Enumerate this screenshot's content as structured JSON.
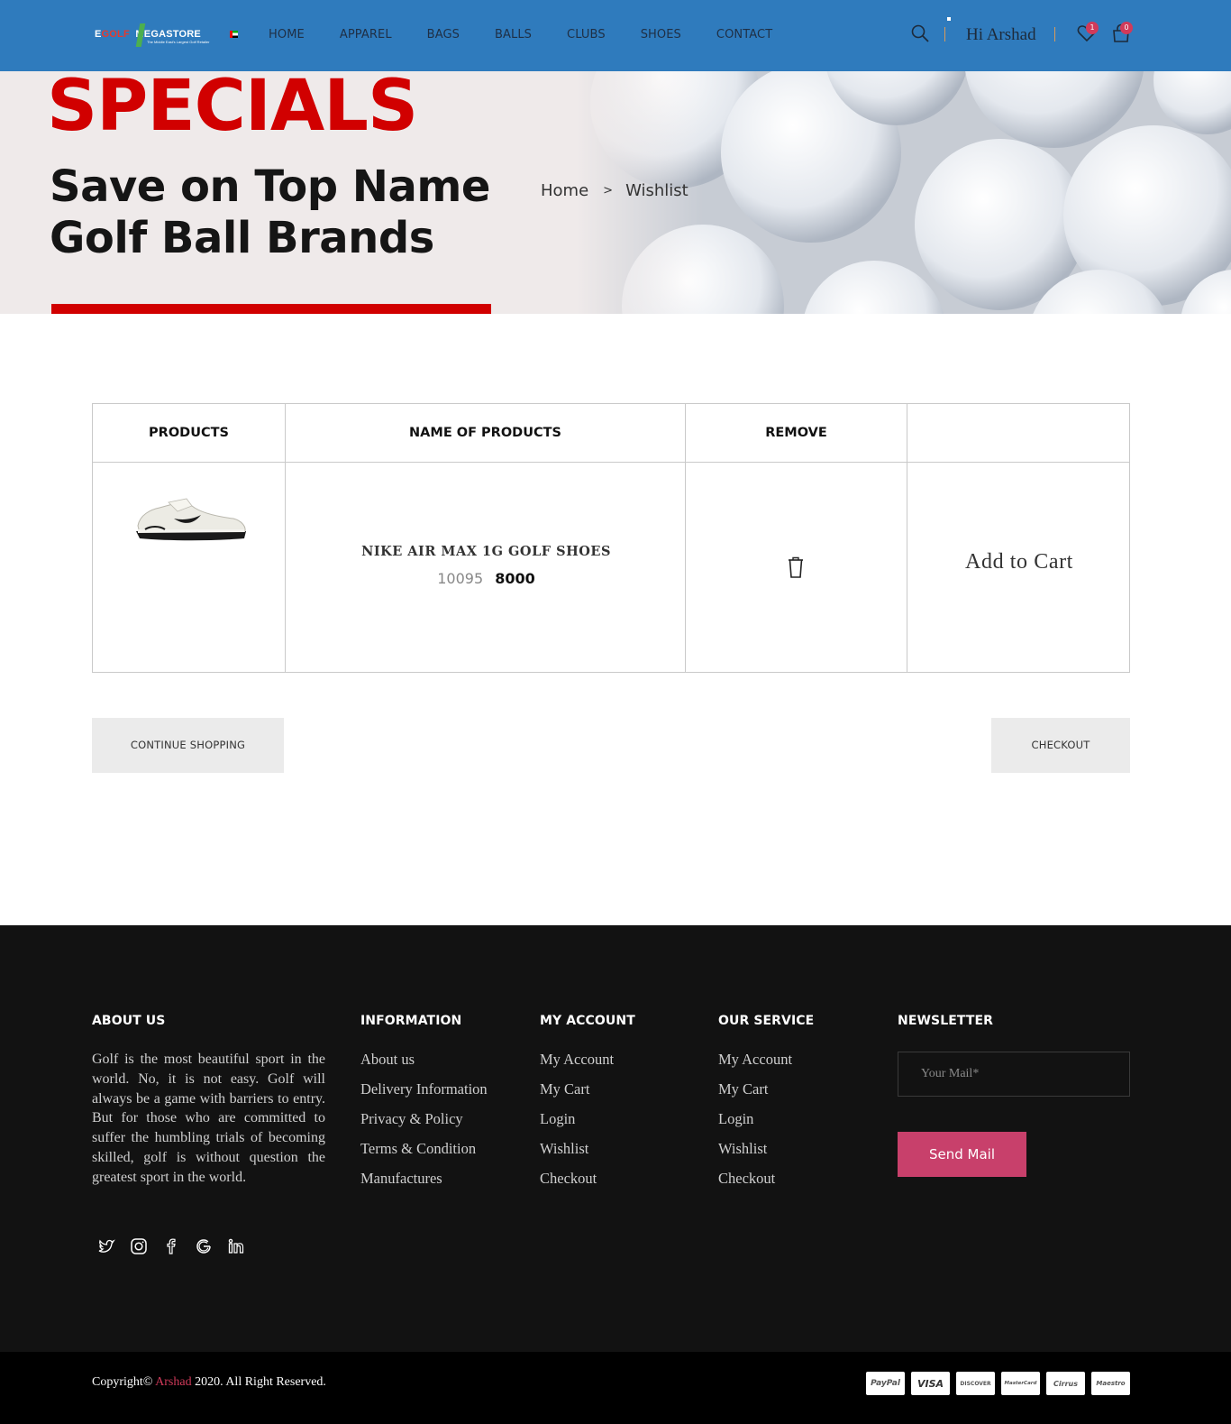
{
  "header": {
    "logo_text_e": "E",
    "logo_text_golf": "GOLF",
    "logo_text_mega": "MEGASTORE",
    "logo_tagline": "The Middle East's Largest Golf Retailer",
    "nav": [
      "HOME",
      "APPAREL",
      "BAGS",
      "BALLS",
      "CLUBS",
      "SHOES",
      "CONTACT"
    ],
    "greeting": "Hi Arshad",
    "wishlist_count": "1",
    "cart_count": "0",
    "icons": [
      "search-icon",
      "heart-icon",
      "shopping-bag-icon"
    ],
    "color": "#2f7bbd"
  },
  "hero": {
    "specials": "SPECIALS",
    "tag_line_1": "Save on Top Name",
    "tag_line_2": "Golf Ball Brands",
    "breadcrumb": {
      "home": "Home",
      "separator": ">",
      "current": "Wishlist"
    }
  },
  "wishlist": {
    "columns": [
      "PRODUCTS",
      "NAME OF PRODUCTS",
      "REMOVE",
      ""
    ],
    "items": [
      {
        "name": "NIKE AIR MAX 1G GOLF SHOES",
        "old_price": "10095",
        "price": "8000",
        "add_to_cart": "Add to Cart"
      }
    ]
  },
  "actions": {
    "continue": "CONTINUE SHOPPING",
    "checkout": "CHECKOUT"
  },
  "footer": {
    "about": {
      "title": "ABOUT US",
      "text": "Golf is the most beautiful sport in the world. No, it is not easy. Golf will always be a game with barriers to entry. But for those who are committed to suffer the humbling trials of becoming skilled, golf is without question the greatest sport in the world."
    },
    "information": {
      "title": "INFORMATION",
      "links": [
        "About us",
        "Delivery Information",
        "Privacy & Policy",
        "Terms & Condition",
        "Manufactures"
      ]
    },
    "my_account": {
      "title": "MY ACCOUNT",
      "links": [
        "My Account",
        "My Cart",
        "Login",
        "Wishlist",
        "Checkout"
      ]
    },
    "our_service": {
      "title": "OUR SERVICE",
      "links": [
        "My Account",
        "My Cart",
        "Login",
        "Wishlist",
        "Checkout"
      ]
    },
    "newsletter": {
      "title": "NEWSLETTER",
      "placeholder": "Your Mail*",
      "button": "Send Mail",
      "button_color": "#c8406b"
    },
    "socials": [
      "twitter-icon",
      "instagram-icon",
      "facebook-icon",
      "google-icon",
      "linkedin-icon"
    ]
  },
  "bottom": {
    "copy_prefix": "Copyright© ",
    "brand": "Arshad",
    "copy_suffix": " 2020. All Right Reserved.",
    "payments": [
      "PayPal",
      "VISA",
      "DISCOVER",
      "MasterCard",
      "Cirrus",
      "Maestro"
    ]
  }
}
